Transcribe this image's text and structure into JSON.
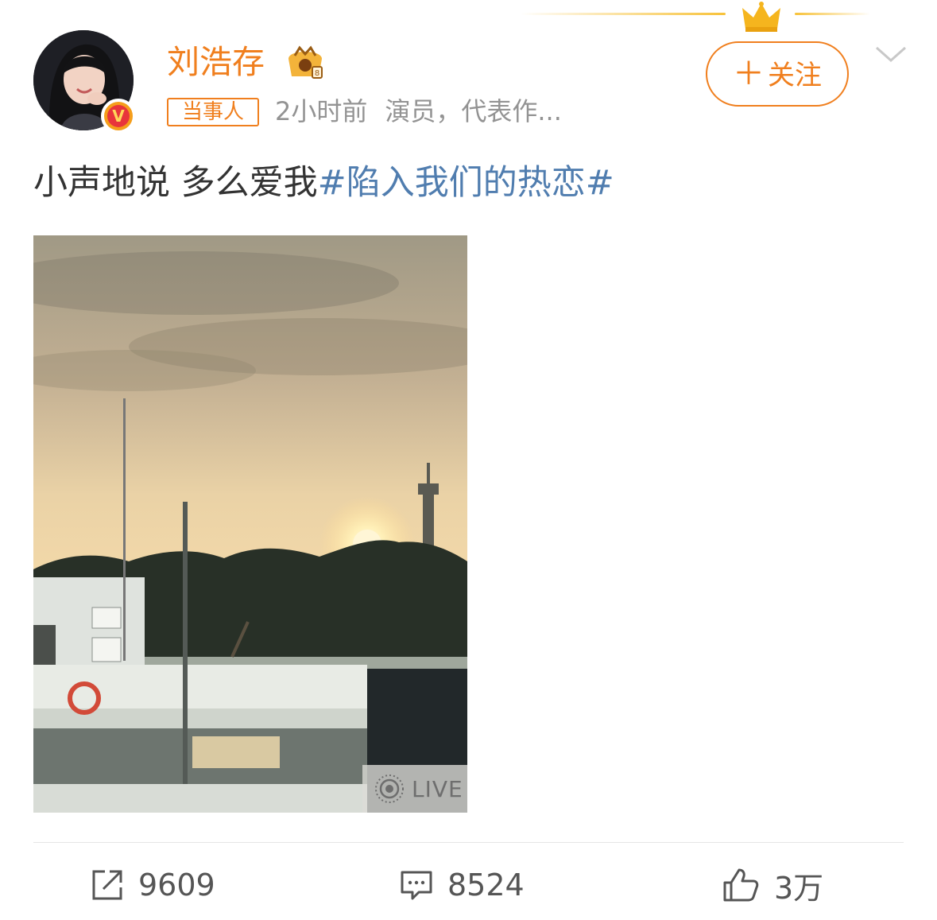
{
  "post": {
    "author": {
      "name": "刘浩存",
      "verified_badge": "V",
      "tag": "当事人",
      "time": "2小时前",
      "description": "演员，代表作...",
      "avatar_icon": "avatar-photo",
      "member_icon": "member-crown-icon"
    },
    "follow_button": {
      "plus": "＋",
      "label": "关注"
    },
    "text": "小声地说 多么爱我",
    "hashtag": "#陷入我们的热恋#",
    "image": {
      "badge": "LIVE",
      "badge_icon": "live-photo-icon"
    },
    "actions": {
      "repost": {
        "icon": "repost-icon",
        "count": "9609"
      },
      "comment": {
        "icon": "comment-icon",
        "count": "8524"
      },
      "like": {
        "icon": "thumbs-up-icon",
        "count": "3万"
      }
    }
  },
  "colors": {
    "brand_orange": "#f07f1e",
    "hashtag_blue": "#507daf",
    "meta_gray": "#939393",
    "gold": "#f7c23a"
  }
}
